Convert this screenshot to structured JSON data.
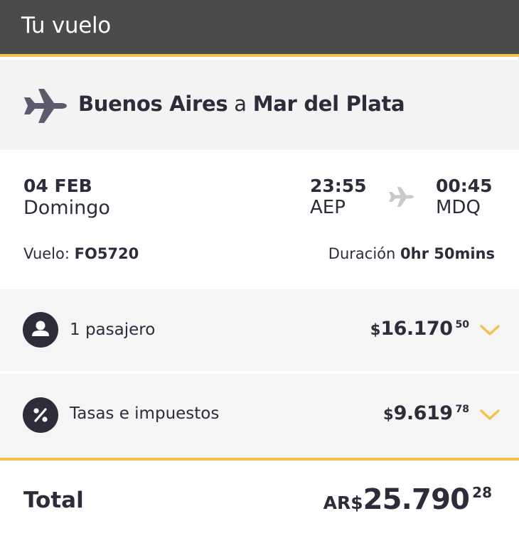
{
  "header": {
    "title": "Tu vuelo"
  },
  "route": {
    "origin": "Buenos Aires",
    "connector": "a",
    "destination": "Mar del Plata",
    "icon": "plane-icon"
  },
  "flight": {
    "date": "04 FEB",
    "weekday": "Domingo",
    "departure_time": "23:55",
    "departure_code": "AEP",
    "arrival_time": "00:45",
    "arrival_code": "MDQ",
    "flight_label": "Vuelo:",
    "flight_number": "FO5720",
    "duration_label": "Duración",
    "duration_value": "0hr 50mins"
  },
  "breakdown": [
    {
      "icon": "user-icon",
      "label": "1 pasajero",
      "currency": "$",
      "integer": "16.170",
      "decimals": "50"
    },
    {
      "icon": "percent-icon",
      "label": "Tasas e impuestos",
      "currency": "$",
      "integer": "9.619",
      "decimals": "78"
    }
  ],
  "total": {
    "label": "Total",
    "currency": "AR$",
    "integer": "25.790",
    "decimals": "28"
  },
  "colors": {
    "header_bg": "#4d4b4a",
    "accent": "#f2c14e",
    "text": "#2c2c3b",
    "plane": "#5c5b6e"
  }
}
